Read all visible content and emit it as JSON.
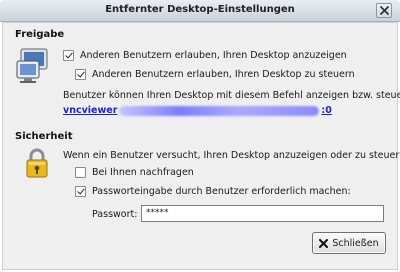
{
  "window": {
    "title": "Entfernter Desktop-Einstellungen"
  },
  "sharing": {
    "heading": "Freigabe",
    "allow_view_label": "Anderen Benutzern erlauben, Ihren Desktop anzuzeigen",
    "allow_view_checked": true,
    "allow_control_label": "Anderen Benutzern erlauben, Ihren Desktop zu steuern",
    "allow_control_checked": true,
    "command_hint": "Benutzer können Ihren Desktop mit diesem Befehl anzeigen bzw. steuern:",
    "command_prefix": "vncviewer",
    "command_suffix": ":0"
  },
  "security": {
    "heading": "Sicherheit",
    "prompt": "Wenn ein Benutzer versucht, Ihren Desktop anzuzeigen oder zu steuern:",
    "ask_label": "Bei Ihnen nachfragen",
    "ask_checked": false,
    "require_password_label": "Passworteingabe durch Benutzer erforderlich machen:",
    "require_password_checked": true,
    "password_label": "Passwort:",
    "password_value": "*****"
  },
  "buttons": {
    "close_label": "Schließen"
  },
  "colors": {
    "link": "#1d1fd6",
    "titlebar": "#c9d1db",
    "dialog_bg": "#efefef"
  }
}
